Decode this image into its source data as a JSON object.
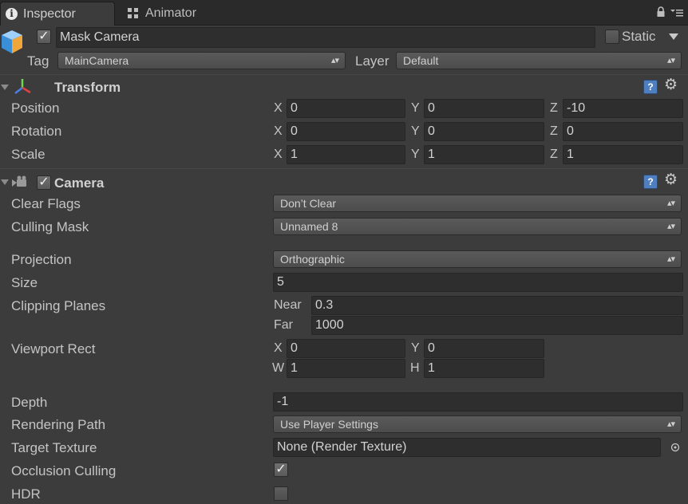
{
  "tabs": {
    "inspector": "Inspector",
    "animator": "Animator"
  },
  "gameobject": {
    "name": "Mask Camera",
    "active": true,
    "static_label": "Static",
    "static": false,
    "tag_label": "Tag",
    "tag": "MainCamera",
    "layer_label": "Layer",
    "layer": "Default"
  },
  "transform": {
    "title": "Transform",
    "rows": [
      {
        "label": "Position",
        "x": "0",
        "y": "0",
        "z": "-10"
      },
      {
        "label": "Rotation",
        "x": "0",
        "y": "0",
        "z": "0"
      },
      {
        "label": "Scale",
        "x": "1",
        "y": "1",
        "z": "1"
      }
    ]
  },
  "camera": {
    "title": "Camera",
    "enabled": true,
    "clear_flags_label": "Clear Flags",
    "clear_flags": "Don’t Clear",
    "culling_mask_label": "Culling Mask",
    "culling_mask": "Unnamed 8",
    "projection_label": "Projection",
    "projection": "Orthographic",
    "size_label": "Size",
    "size": "5",
    "clipping_label": "Clipping Planes",
    "near_label": "Near",
    "near": "0.3",
    "far_label": "Far",
    "far": "1000",
    "viewport_label": "Viewport Rect",
    "viewport": {
      "x": "0",
      "y": "0",
      "w": "1",
      "h": "1"
    },
    "depth_label": "Depth",
    "depth": "-1",
    "rendering_path_label": "Rendering Path",
    "rendering_path": "Use Player Settings",
    "target_texture_label": "Target Texture",
    "target_texture": "None (Render Texture)",
    "occlusion_label": "Occlusion Culling",
    "occlusion": true,
    "hdr_label": "HDR",
    "hdr": false
  },
  "axes": {
    "x": "X",
    "y": "Y",
    "z": "Z",
    "w": "W",
    "h": "H"
  },
  "colors": {
    "background": "#3c3c3c",
    "field": "#2e2e2e",
    "text": "#c8c8c8",
    "help_icon": "#4f7fbf"
  },
  "icons": [
    "info-icon",
    "animator-icon",
    "lock-icon",
    "menu-icon",
    "gameobject-cube-icon",
    "transform-icon",
    "camera-icon",
    "help-icon",
    "gear-icon",
    "object-picker-icon"
  ]
}
